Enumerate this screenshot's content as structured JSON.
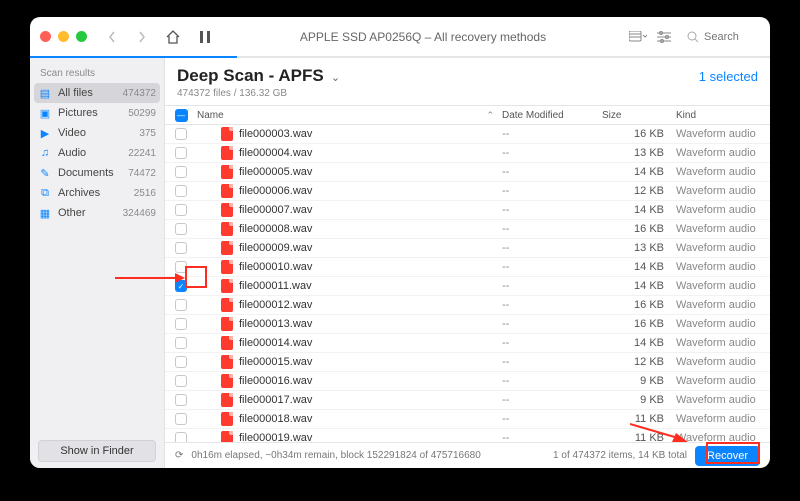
{
  "titlebar": {
    "device": "APPLE SSD AP0256Q",
    "mode": "All recovery methods",
    "search_placeholder": "Search"
  },
  "sidebar": {
    "header": "Scan results",
    "items": [
      {
        "icon": "files-icon",
        "label": "All files",
        "count": "474372"
      },
      {
        "icon": "pictures-icon",
        "label": "Pictures",
        "count": "50299"
      },
      {
        "icon": "video-icon",
        "label": "Video",
        "count": "375"
      },
      {
        "icon": "audio-icon",
        "label": "Audio",
        "count": "22241"
      },
      {
        "icon": "documents-icon",
        "label": "Documents",
        "count": "74472"
      },
      {
        "icon": "archives-icon",
        "label": "Archives",
        "count": "2516"
      },
      {
        "icon": "other-icon",
        "label": "Other",
        "count": "324469"
      }
    ],
    "footer_button": "Show in Finder"
  },
  "main": {
    "title": "Deep Scan - APFS",
    "subtitle": "474372 files / 136.32 GB",
    "selected": "1 selected",
    "columns": {
      "name": "Name",
      "date": "Date Modified",
      "size": "Size",
      "kind": "Kind"
    }
  },
  "rows": [
    {
      "name": "file000003.wav",
      "date": "--",
      "size": "16 KB",
      "kind": "Waveform audio",
      "checked": false
    },
    {
      "name": "file000004.wav",
      "date": "--",
      "size": "13 KB",
      "kind": "Waveform audio",
      "checked": false
    },
    {
      "name": "file000005.wav",
      "date": "--",
      "size": "14 KB",
      "kind": "Waveform audio",
      "checked": false
    },
    {
      "name": "file000006.wav",
      "date": "--",
      "size": "12 KB",
      "kind": "Waveform audio",
      "checked": false
    },
    {
      "name": "file000007.wav",
      "date": "--",
      "size": "14 KB",
      "kind": "Waveform audio",
      "checked": false
    },
    {
      "name": "file000008.wav",
      "date": "--",
      "size": "16 KB",
      "kind": "Waveform audio",
      "checked": false
    },
    {
      "name": "file000009.wav",
      "date": "--",
      "size": "13 KB",
      "kind": "Waveform audio",
      "checked": false
    },
    {
      "name": "file000010.wav",
      "date": "--",
      "size": "14 KB",
      "kind": "Waveform audio",
      "checked": false
    },
    {
      "name": "file000011.wav",
      "date": "--",
      "size": "14 KB",
      "kind": "Waveform audio",
      "checked": true
    },
    {
      "name": "file000012.wav",
      "date": "--",
      "size": "16 KB",
      "kind": "Waveform audio",
      "checked": false
    },
    {
      "name": "file000013.wav",
      "date": "--",
      "size": "16 KB",
      "kind": "Waveform audio",
      "checked": false
    },
    {
      "name": "file000014.wav",
      "date": "--",
      "size": "14 KB",
      "kind": "Waveform audio",
      "checked": false
    },
    {
      "name": "file000015.wav",
      "date": "--",
      "size": "12 KB",
      "kind": "Waveform audio",
      "checked": false
    },
    {
      "name": "file000016.wav",
      "date": "--",
      "size": "9 KB",
      "kind": "Waveform audio",
      "checked": false
    },
    {
      "name": "file000017.wav",
      "date": "--",
      "size": "9 KB",
      "kind": "Waveform audio",
      "checked": false
    },
    {
      "name": "file000018.wav",
      "date": "--",
      "size": "11 KB",
      "kind": "Waveform audio",
      "checked": false
    },
    {
      "name": "file000019.wav",
      "date": "--",
      "size": "11 KB",
      "kind": "Waveform audio",
      "checked": false
    }
  ],
  "statusbar": {
    "spinner": "⟳",
    "text": "0h16m elapsed, ~0h34m remain, block 152291824 of 475716680",
    "summary": "1 of 474372 items, 14 KB total",
    "recover": "Recover"
  }
}
